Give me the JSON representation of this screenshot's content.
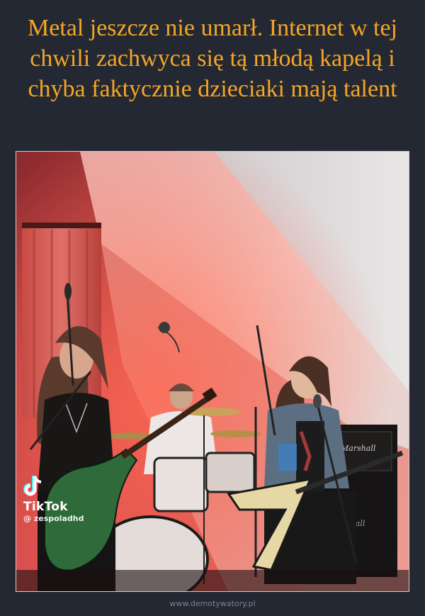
{
  "title": "Metal jeszcze nie umarł. Internet w tej chwili zachwyca się tą młodą kapelą i chyba faktycznie dzieciaki mają talent",
  "overlay": {
    "brand": "TikTok",
    "handle": "@ zespoladhd",
    "icon": "tiktok-logo-icon"
  },
  "footer": {
    "watermark": "www.demotywatory.pl"
  },
  "colors": {
    "background": "#232833",
    "title": "#f5a623",
    "frame_border": "#cfcfcf"
  }
}
